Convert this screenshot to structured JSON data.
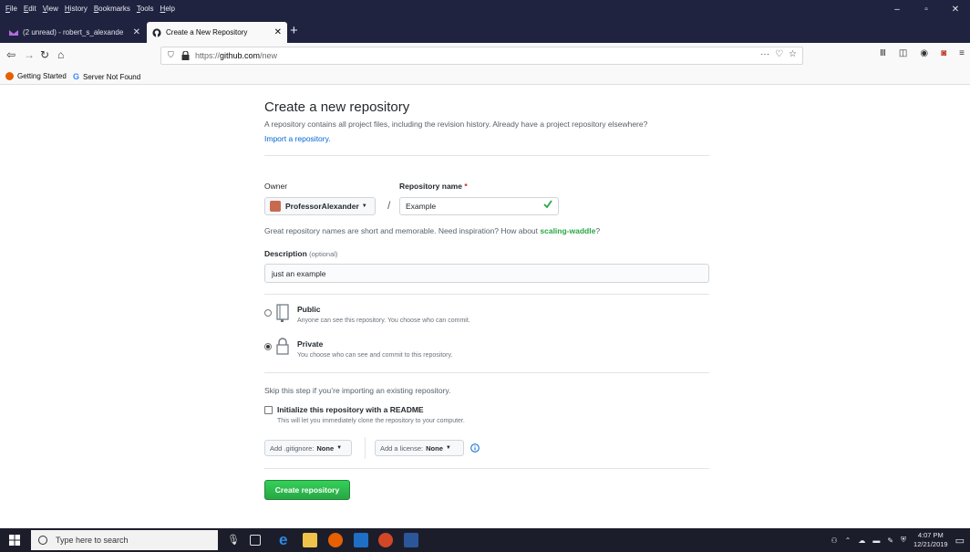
{
  "browser": {
    "menu": [
      "File",
      "Edit",
      "View",
      "History",
      "Bookmarks",
      "Tools",
      "Help"
    ],
    "window_controls": [
      "–",
      "▫",
      "✕"
    ],
    "tabs": [
      {
        "title": "(2 unread) - robert_s_alexande",
        "close": "✕"
      },
      {
        "title": "Create a New Repository",
        "close": "✕"
      }
    ],
    "new_tab": "+",
    "url_prefix": "https://",
    "url_host": "github.com",
    "url_path": "/new",
    "url_actions": "···",
    "bookmarks": [
      "Getting Started",
      "Server Not Found"
    ]
  },
  "page": {
    "title": "Create a new repository",
    "subtitle": "A repository contains all project files, including the revision history. Already have a project repository elsewhere?",
    "import_link": "Import a repository.",
    "owner_label": "Owner",
    "owner_value": "ProfessorAlexander",
    "repo_label": "Repository name",
    "required_mark": "*",
    "slash": "/",
    "repo_value": "Example",
    "hint_prefix": "Great repository names are short and memorable. Need inspiration? How about",
    "hint_suggestion": "scaling-waddle",
    "hint_suffix": "?",
    "description_label": "Description",
    "optional_label": "(optional)",
    "description_value": "just an example",
    "public_title": "Public",
    "public_note": "Anyone can see this repository. You choose who can commit.",
    "private_title": "Private",
    "private_note": "You choose who can see and commit to this repository.",
    "visibility_selected": "private",
    "skip_note": "Skip this step if you’re importing an existing repository.",
    "init_label": "Initialize this repository with a README",
    "init_note": "This will let you immediately clone the repository to your computer.",
    "gitignore_label": "Add .gitignore:",
    "gitignore_value": "None",
    "license_label": "Add a license:",
    "license_value": "None",
    "create_button": "Create repository"
  },
  "taskbar": {
    "search_placeholder": "Type here to search",
    "time": "4:07 PM",
    "date": "12/21/2019"
  },
  "colors": {
    "firefox_dark": "#202340",
    "create_green": "#28a745",
    "suggestion_green": "#28a745",
    "link_blue": "#0366d6",
    "taskbar": "#1c1d2b"
  }
}
